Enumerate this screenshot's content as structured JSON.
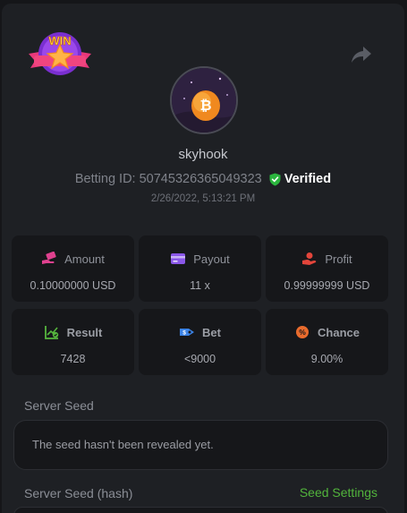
{
  "profile": {
    "username": "skyhook",
    "betting_id": "Betting ID: 50745326365049323",
    "verified": "Verified",
    "timestamp": "2/26/2022, 5:13:21 PM"
  },
  "badge": {
    "text": "WIN"
  },
  "stats": [
    {
      "label": "Amount",
      "value": "0.10000000 USD",
      "icon": "amount-hand-icon",
      "color": "#e0418f"
    },
    {
      "label": "Payout",
      "value": "11 x",
      "icon": "wallet-card-icon",
      "color": "#8a57e8"
    },
    {
      "label": "Profit",
      "value": "0.99999999 USD",
      "icon": "profit-hand-icon",
      "color": "#e3453b"
    },
    {
      "label": "Result",
      "value": "7428",
      "icon": "result-chart-icon",
      "color": "#56b63e"
    },
    {
      "label": "Bet",
      "value": "<9000",
      "icon": "bet-tag-icon",
      "color": "#3b83e6"
    },
    {
      "label": "Chance",
      "value": "9.00%",
      "icon": "percent-icon",
      "color": "#e86b2d"
    }
  ],
  "server_seed": {
    "label": "Server Seed",
    "text": "The seed hasn't been revealed yet.",
    "hash_label": "Server Seed (hash)",
    "settings_link": "Seed Settings"
  },
  "colors": {
    "background": "#151619",
    "panel": "#1e2024",
    "card": "#16171a",
    "accent_green": "#52b43c",
    "verified_shield": "#2bb53e"
  }
}
